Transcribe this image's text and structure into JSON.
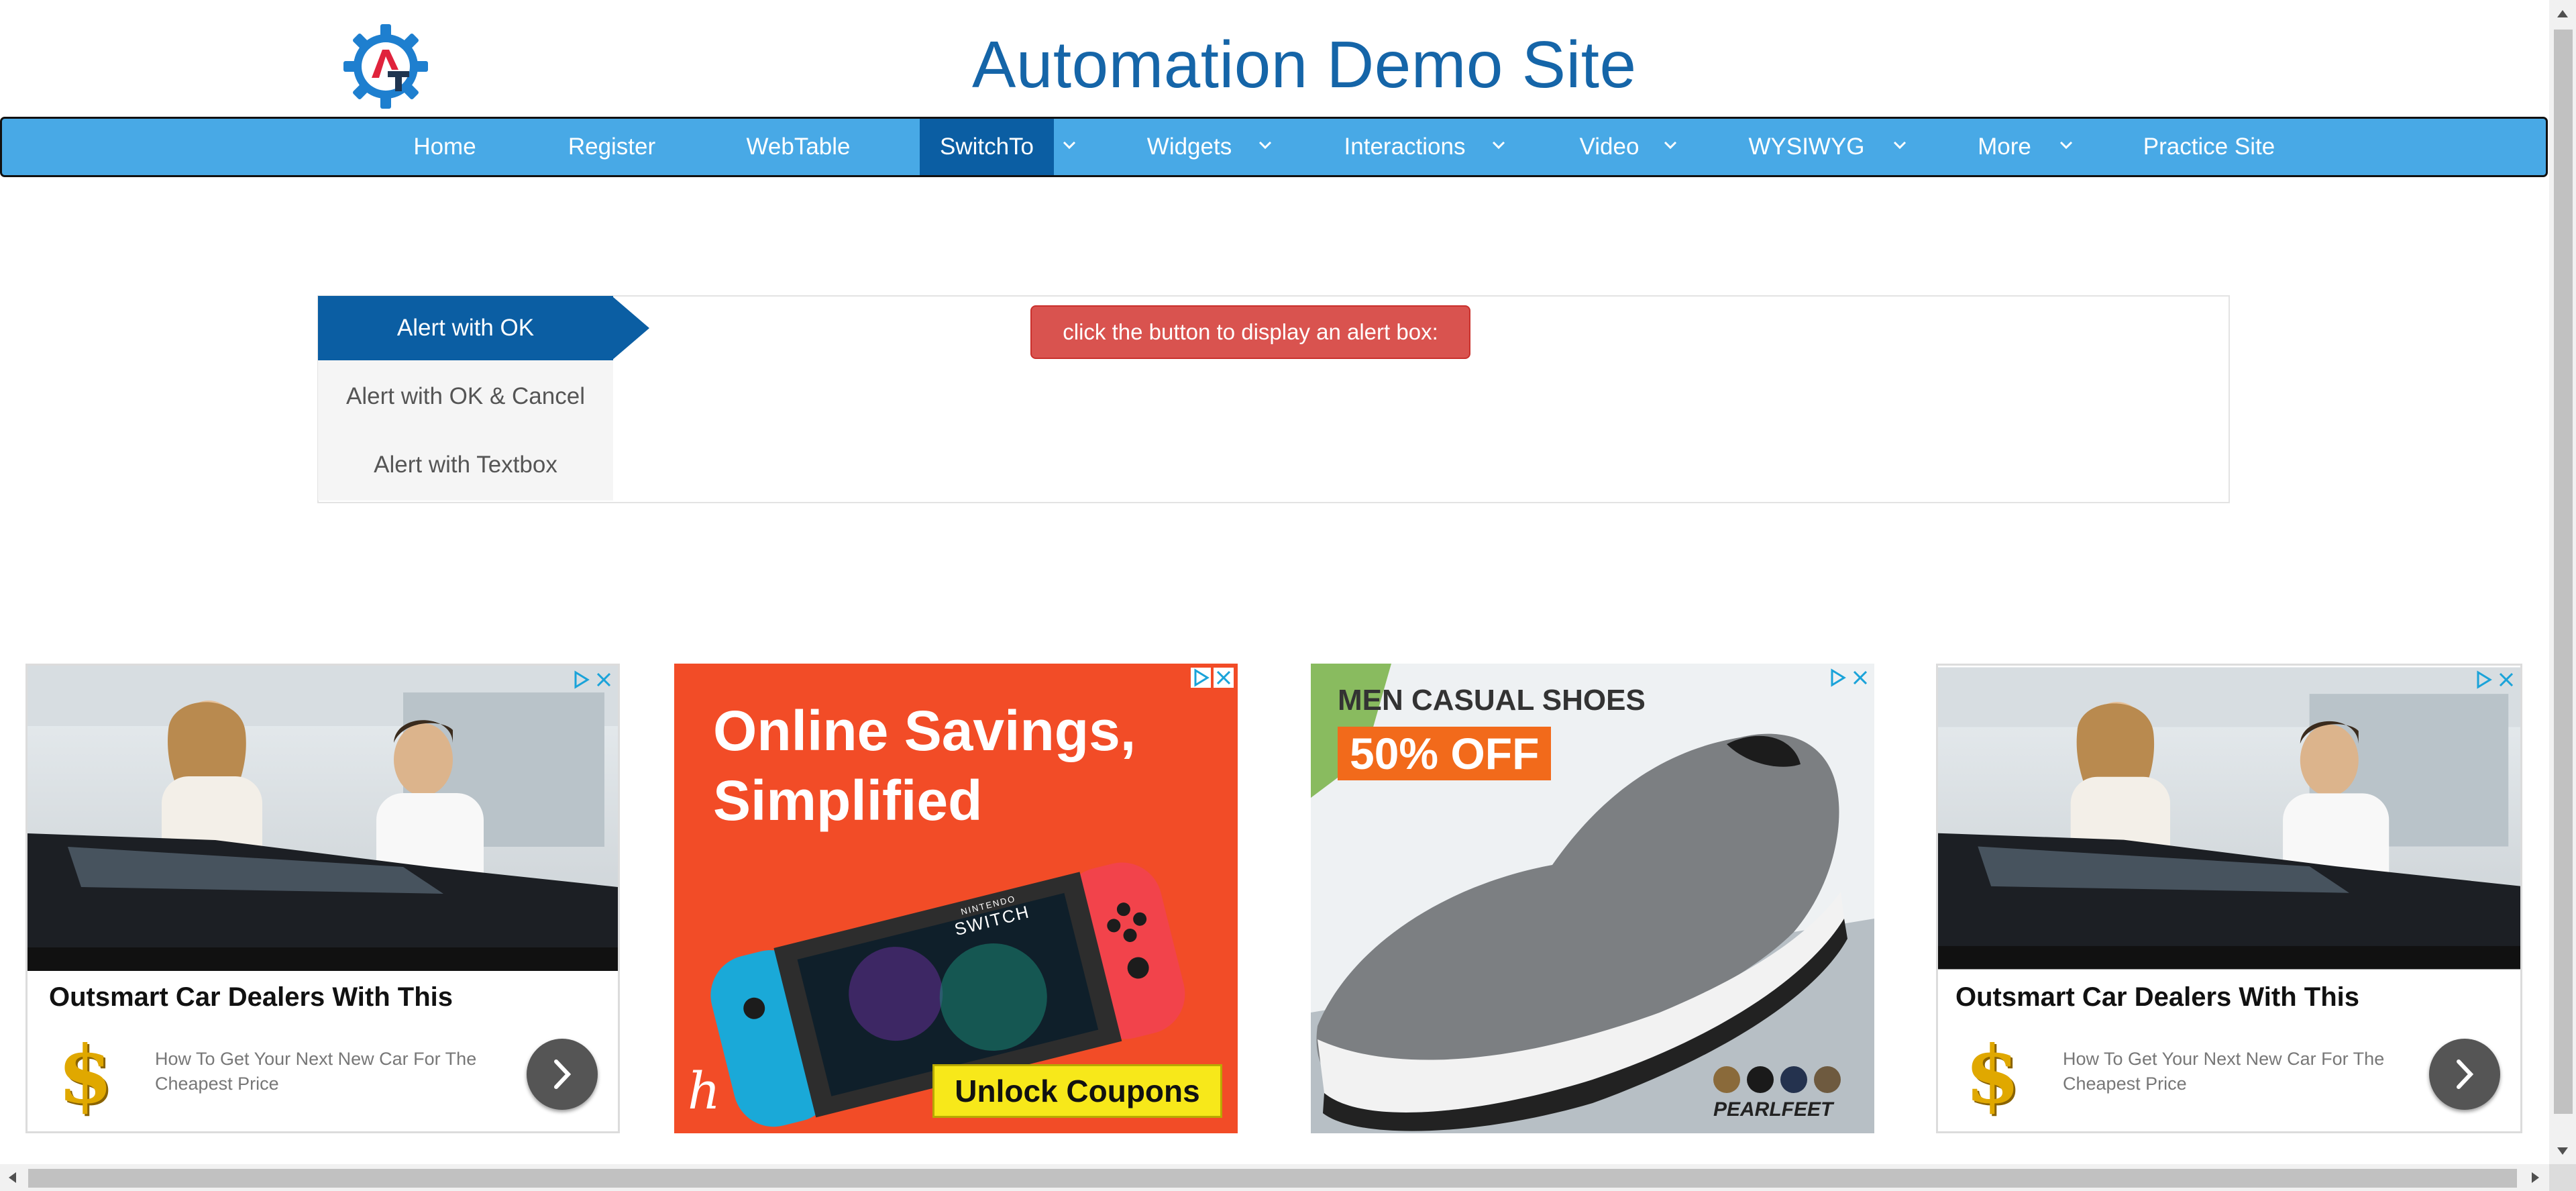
{
  "header": {
    "site_title": "Automation Demo Site",
    "logo_text": "AT",
    "logo_colors": {
      "gear": "#1e7fcf",
      "a": "#e0233c",
      "t": "#1f3550"
    }
  },
  "nav": {
    "items": [
      {
        "label": "Home",
        "dropdown": false,
        "active": false
      },
      {
        "label": "Register",
        "dropdown": false,
        "active": false
      },
      {
        "label": "WebTable",
        "dropdown": false,
        "active": false
      },
      {
        "label": "SwitchTo",
        "dropdown": true,
        "active": true
      },
      {
        "label": "Widgets",
        "dropdown": true,
        "active": false
      },
      {
        "label": "Interactions",
        "dropdown": true,
        "active": false
      },
      {
        "label": "Video",
        "dropdown": true,
        "active": false
      },
      {
        "label": "WYSIWYG",
        "dropdown": true,
        "active": false
      },
      {
        "label": "More",
        "dropdown": true,
        "active": false
      },
      {
        "label": "Practice Site",
        "dropdown": false,
        "active": false
      }
    ],
    "colors": {
      "bar": "#48a9e6",
      "active": "#0b5ea3"
    }
  },
  "alerts": {
    "tabs": [
      {
        "label": "Alert with OK",
        "active": true
      },
      {
        "label": "Alert with OK & Cancel",
        "active": false
      },
      {
        "label": "Alert with Textbox",
        "active": false
      }
    ],
    "button_label": "click the button to display an alert box:",
    "button_color": "#d9534f"
  },
  "ads": {
    "car": {
      "headline": "Outsmart Car Dealers With This",
      "description": "How To Get Your Next New Car For The Cheapest Price",
      "icon": "dollar-icon"
    },
    "switch": {
      "headline_line1": "Online Savings,",
      "headline_line2": "Simplified",
      "cta": "Unlock Coupons",
      "brand_glyph": "h",
      "console_line1": "NINTENDO",
      "console_line2": "SWITCH",
      "bg_color": "#f24c27"
    },
    "shoes": {
      "headline": "MEN CASUAL SHOES",
      "discount": "50% OFF",
      "brand": "PEARLFEET"
    }
  }
}
